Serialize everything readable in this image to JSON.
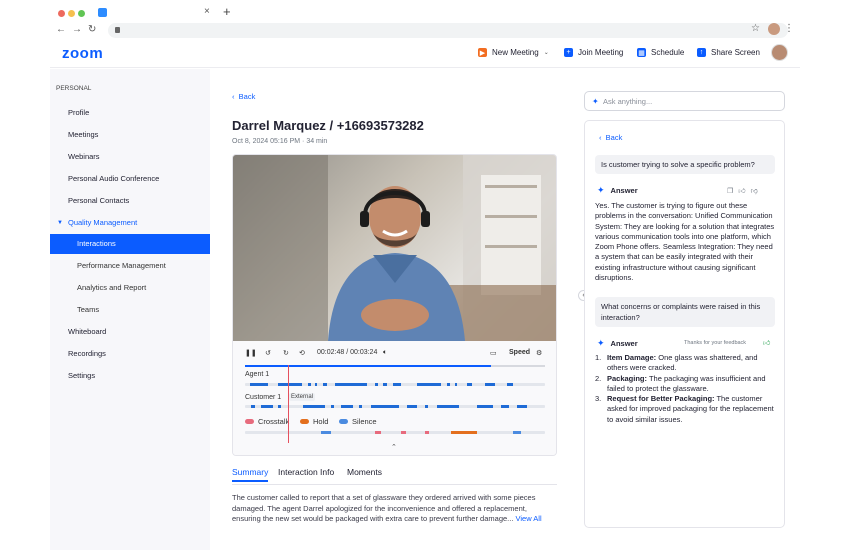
{
  "browser": {
    "close_glyph": "×",
    "new_tab_glyph": "+",
    "back_glyph": "←",
    "forward_glyph": "→",
    "reload_glyph": "↻",
    "star_glyph": "☆",
    "more_glyph": "⋮"
  },
  "header": {
    "logo": "zoom",
    "new_meeting": "New Meeting",
    "join_meeting": "Join Meeting",
    "schedule": "Schedule",
    "share_screen": "Share Screen"
  },
  "sidebar": {
    "section": "PERSONAL",
    "items": [
      {
        "label": "Profile"
      },
      {
        "label": "Meetings"
      },
      {
        "label": "Webinars"
      },
      {
        "label": "Personal Audio Conference"
      },
      {
        "label": "Personal Contacts"
      },
      {
        "label": "Quality Management"
      },
      {
        "label": "Interactions"
      },
      {
        "label": "Performance Management"
      },
      {
        "label": "Analytics and Report"
      },
      {
        "label": "Teams"
      },
      {
        "label": "Whiteboard"
      },
      {
        "label": "Recordings"
      },
      {
        "label": "Settings"
      }
    ]
  },
  "main": {
    "back": "Back",
    "title": "Darrel Marquez / +16693573282",
    "subtitle": "Oct 8, 2024 05:16 PM · 34 min",
    "player": {
      "time": "00:02:48 / 00:03:24",
      "speed": "Speed",
      "progress": 0.82,
      "tracks": [
        {
          "label": "Agent 1"
        },
        {
          "label": "Customer 1"
        }
      ],
      "external_tag": "External",
      "legend": [
        "Crosstalk",
        "Hold",
        "Silence"
      ]
    },
    "tabs": [
      "Summary",
      "Interaction Info",
      "Moments"
    ],
    "summary": "The customer called to report that a set of glassware they ordered arrived with some pieces damaged. The agent Darrel apologized for the inconvenience and offered a replacement, ensuring the new set would be packaged with extra care to prevent further damage...",
    "view_all": "View All"
  },
  "assistant": {
    "placeholder": "Ask anything...",
    "back": "Back",
    "q1": "Is customer trying to solve a specific problem?",
    "answer_label": "Answer",
    "a1": "Yes. The customer is trying to figure out these problems in the conversation: Unified Communication System: They are looking for a solution that integrates various communication tools into one platform, which Zoom Phone offers. Seamless Integration: They need a system that can be easily integrated with their existing infrastructure without causing significant disruptions.",
    "q2": "What concerns or complaints were raised in this interaction?",
    "feedback": "Thanks for your feedback",
    "a2": [
      {
        "num": "1.",
        "head": "Item Damage:",
        "text": " One glass was shattered, and others were cracked."
      },
      {
        "num": "2.",
        "head": "Packaging:",
        "text": " The packaging was insufficient and failed to protect the glassware."
      },
      {
        "num": "3.",
        "head": "Request for Better Packaging:",
        "text": " The customer asked for improved packaging for the replacement to avoid similar issues."
      }
    ]
  },
  "colors": {
    "brand": "#0b5cff",
    "segment_blue": "#1f6bd6",
    "hold_orange": "#e36f1e",
    "crosstalk_pink": "#e76b7d",
    "silence_blue": "#4b8be0"
  }
}
